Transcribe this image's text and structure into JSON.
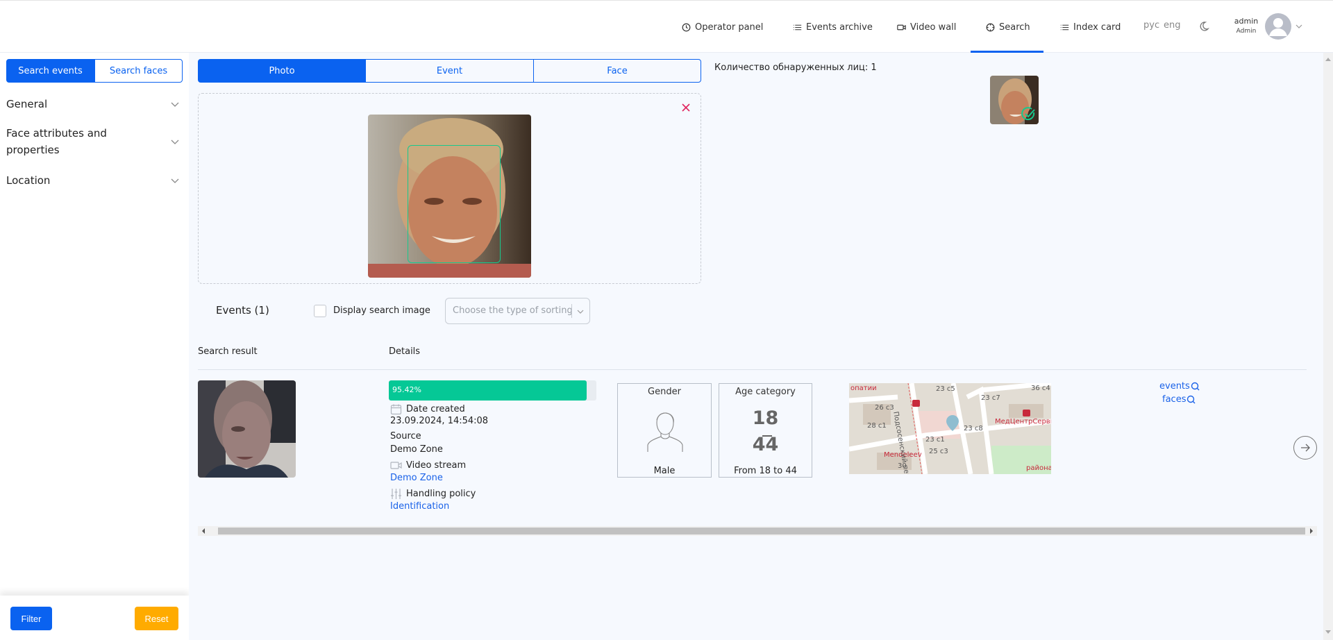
{
  "header": {
    "nav": [
      {
        "label": "Operator panel",
        "icon": "clock-icon"
      },
      {
        "label": "Events archive",
        "icon": "list-icon"
      },
      {
        "label": "Video wall",
        "icon": "video-camera-icon"
      },
      {
        "label": "Search",
        "icon": "crosshair-icon",
        "active": true
      },
      {
        "label": "Index card",
        "icon": "list-icon"
      }
    ],
    "languages": [
      "рус",
      "eng"
    ],
    "theme_icon": "moon-icon",
    "user": {
      "name": "admin",
      "role": "Admin"
    }
  },
  "sidebar": {
    "mode_buttons": [
      {
        "label": "Search events",
        "active": true
      },
      {
        "label": "Search faces",
        "active": false
      }
    ],
    "sections": [
      {
        "label": "General"
      },
      {
        "label": "Face attributes and properties"
      },
      {
        "label": "Location"
      }
    ],
    "filter_label": "Filter",
    "reset_label": "Reset"
  },
  "search_input": {
    "tabs": [
      {
        "label": "Photo",
        "active": true
      },
      {
        "label": "Event",
        "active": false
      },
      {
        "label": "Face",
        "active": false
      }
    ],
    "detected_faces_label": "Количество обнаруженных лиц: 1"
  },
  "results": {
    "events_label": "Events (1)",
    "display_search_image_label": "Display search image",
    "display_search_image_checked": false,
    "sort_placeholder": "Choose the type of sorting",
    "columns": [
      "Search result",
      "Details"
    ],
    "items": [
      {
        "similarity_text": "95.42%",
        "similarity": 95.42,
        "date_label": "Date created",
        "date_value": "23.09.2024, 14:54:08",
        "source_label": "Source",
        "source_value": "Demo Zone",
        "stream_label": "Video stream",
        "stream_value": "Demo Zone",
        "policy_label": "Handling policy",
        "policy_value": "Identification",
        "gender_title": "Gender",
        "gender_value": "Male",
        "age_title": "Age category",
        "age_from": "18",
        "age_to": "44",
        "age_value": "From 18 to 44",
        "map_labels": [
          "опатии",
          "23 с5",
          "23 с7",
          "36 с4",
          "26 с3",
          "28 с1",
          "23 с8",
          "23 с1",
          "25 с3",
          "30",
          "Mendeleev",
          "МедЦентрСервис",
          "Подсосенский переул",
          "района"
        ],
        "links": [
          "events",
          "faces"
        ]
      }
    ]
  },
  "colors": {
    "primary": "#0a62f0",
    "reset": "#ffab00",
    "similarity": "#05c896",
    "close": "#e0245e"
  }
}
